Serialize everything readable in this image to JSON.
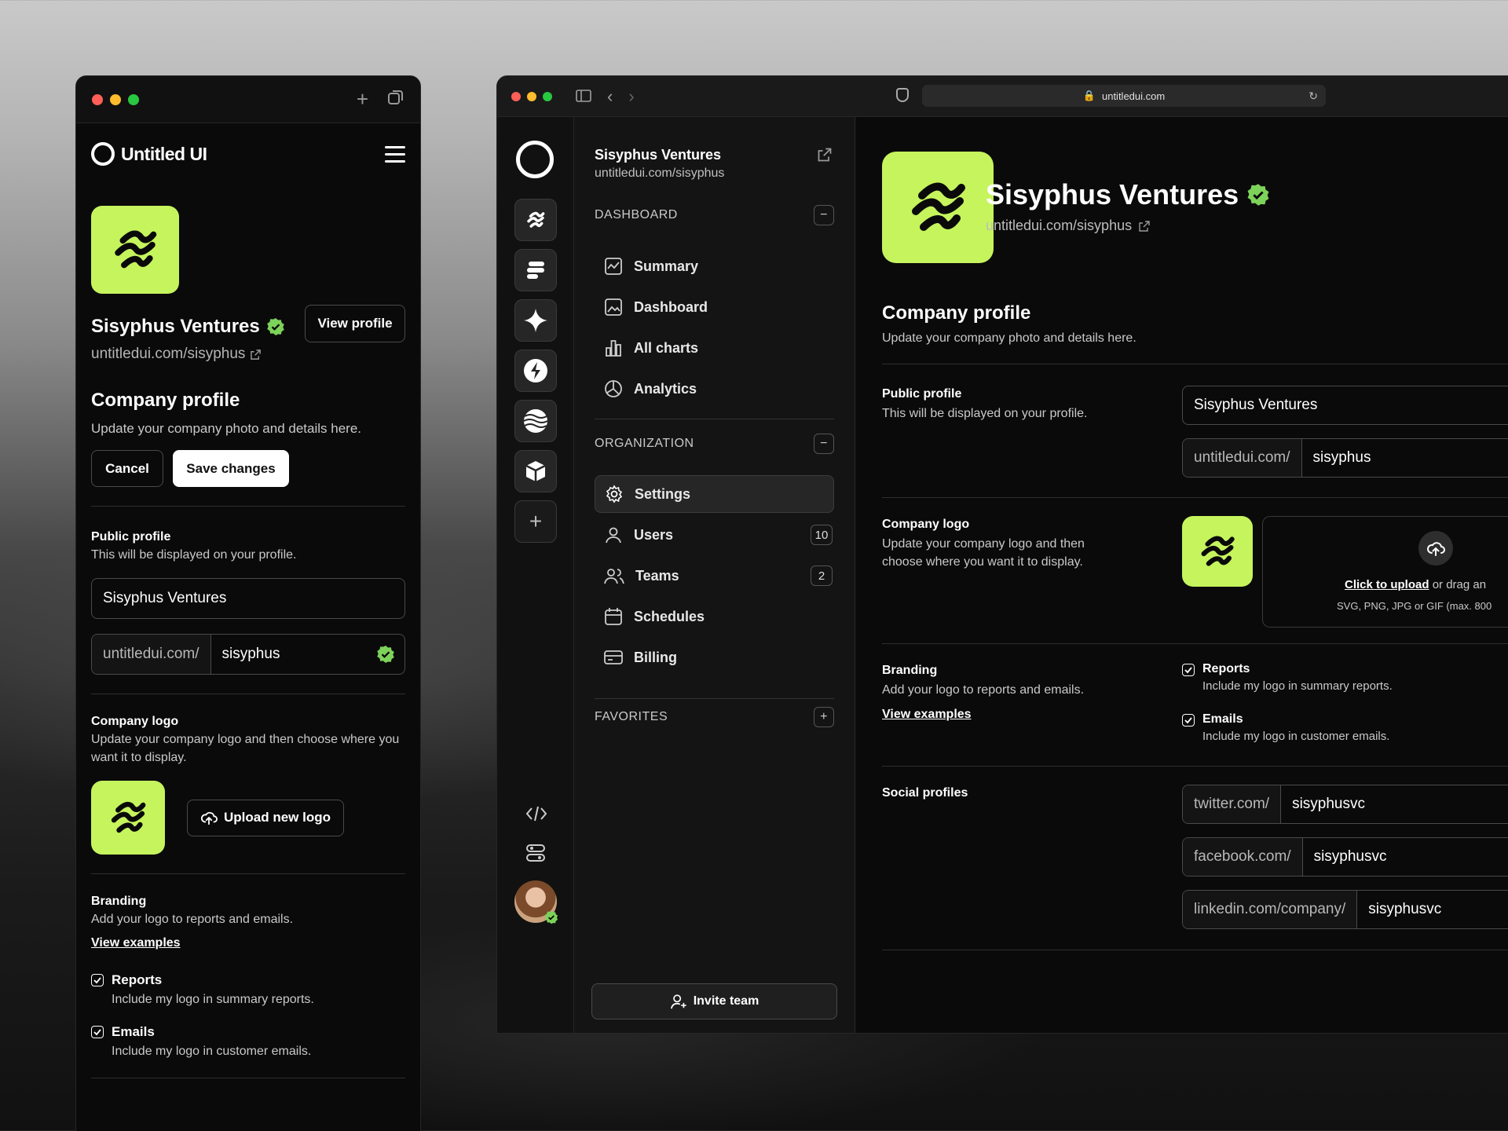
{
  "mobile": {
    "brand": "Untitled UI",
    "company_name": "Sisyphus Ventures",
    "company_url": "untitledui.com/sisyphus",
    "view_profile_label": "View profile",
    "section_title": "Company profile",
    "section_sub": "Update your company photo and details here.",
    "cancel_label": "Cancel",
    "save_label": "Save changes",
    "public_profile": {
      "title": "Public profile",
      "sub": "This will be displayed on your profile.",
      "name_value": "Sisyphus Ventures",
      "url_prefix": "untitledui.com/",
      "url_value": "sisyphus"
    },
    "company_logo": {
      "title": "Company logo",
      "sub": "Update your company logo and then choose where you want it to display.",
      "upload_label": "Upload new logo"
    },
    "branding": {
      "title": "Branding",
      "sub": "Add your logo to reports and emails.",
      "link": "View examples"
    },
    "reports": {
      "title": "Reports",
      "sub": "Include my logo in summary reports."
    },
    "emails": {
      "title": "Emails",
      "sub": "Include my logo in customer emails."
    }
  },
  "desktop": {
    "address": "untitledui.com",
    "sidebar": {
      "title": "Sisyphus Ventures",
      "url": "untitledui.com/sisyphus",
      "dashboard_label": "DASHBOARD",
      "dashboard_items": [
        "Summary",
        "Dashboard",
        "All charts",
        "Analytics"
      ],
      "organization_label": "ORGANIZATION",
      "org_items": [
        {
          "label": "Settings",
          "badge": ""
        },
        {
          "label": "Users",
          "badge": "10"
        },
        {
          "label": "Teams",
          "badge": "2"
        },
        {
          "label": "Schedules",
          "badge": ""
        },
        {
          "label": "Billing",
          "badge": ""
        }
      ],
      "favorites_label": "FAVORITES",
      "invite_label": "Invite team"
    },
    "main": {
      "company_name": "Sisyphus Ventures",
      "company_url": "untitledui.com/sisyphus",
      "section_title": "Company profile",
      "section_sub": "Update your company photo and details here.",
      "public_profile": {
        "title": "Public profile",
        "sub": "This will be displayed on your profile.",
        "name_value": "Sisyphus Ventures",
        "url_prefix": "untitledui.com/",
        "url_value": "sisyphus"
      },
      "company_logo": {
        "title": "Company logo",
        "sub_line1": "Update your company logo and then",
        "sub_line2": "choose where you want it to display.",
        "upload_link": "Click to upload",
        "upload_rest": "or drag an",
        "upload_types": "SVG, PNG, JPG or GIF (max. 800"
      },
      "branding": {
        "title": "Branding",
        "sub": "Add your logo to reports and emails.",
        "link": "View examples"
      },
      "reports": {
        "title": "Reports",
        "sub": "Include my logo in summary reports."
      },
      "emails": {
        "title": "Emails",
        "sub": "Include my logo in customer emails."
      },
      "social": {
        "title": "Social profiles",
        "items": [
          {
            "prefix": "twitter.com/",
            "value": "sisyphusvc"
          },
          {
            "prefix": "facebook.com/",
            "value": "sisyphusvc"
          },
          {
            "prefix": "linkedin.com/company/",
            "value": "sisyphusvc"
          }
        ]
      }
    }
  },
  "colors": {
    "accent": "#c5f45d",
    "verified": "#7dd35a",
    "background": "#0a0a0a"
  }
}
